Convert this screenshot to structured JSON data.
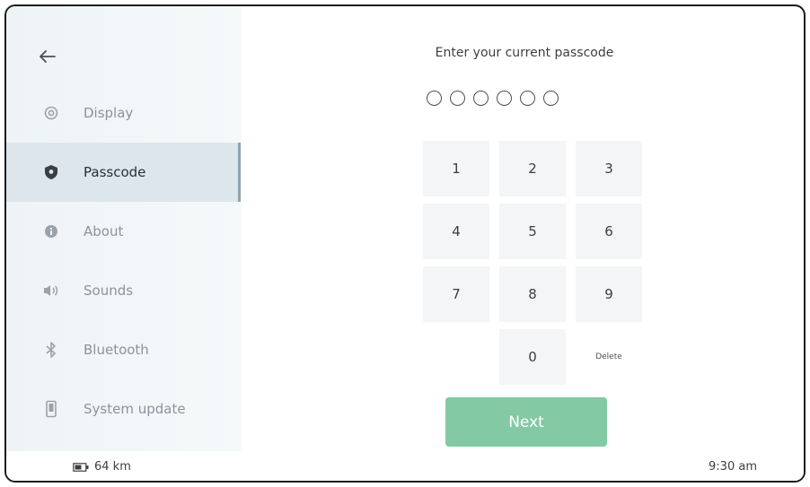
{
  "sidebar": {
    "items": [
      {
        "label": "Display",
        "icon": "settings-icon"
      },
      {
        "label": "Passcode",
        "icon": "shield-icon",
        "selected": true
      },
      {
        "label": "About",
        "icon": "info-icon"
      },
      {
        "label": "Sounds",
        "icon": "speaker-icon"
      },
      {
        "label": "Bluetooth",
        "icon": "bluetooth-icon"
      },
      {
        "label": "System update",
        "icon": "phone-icon"
      }
    ]
  },
  "main": {
    "title": "Enter your current passcode",
    "passcode_length": 6,
    "keys": [
      "1",
      "2",
      "3",
      "4",
      "5",
      "6",
      "7",
      "8",
      "9",
      "0"
    ],
    "delete_label": "Delete",
    "next_label": "Next"
  },
  "footer": {
    "range": "64 km",
    "time": "9:30 am"
  },
  "colors": {
    "accent": "#83c9a4",
    "sidebar_bg": "#eef3f6",
    "selected_bg": "#dde6ec"
  }
}
